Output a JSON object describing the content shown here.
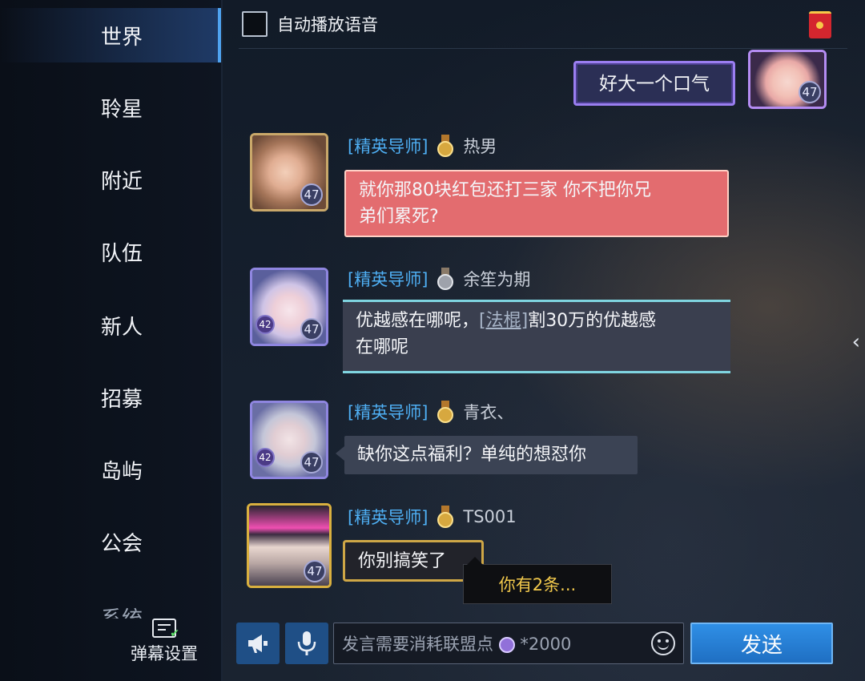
{
  "sidebar": {
    "items": [
      {
        "label": "世界",
        "active": true
      },
      {
        "label": "聆星"
      },
      {
        "label": "附近"
      },
      {
        "label": "队伍"
      },
      {
        "label": "新人"
      },
      {
        "label": "招募"
      },
      {
        "label": "岛屿"
      },
      {
        "label": "公会"
      },
      {
        "label": "系统"
      }
    ],
    "danmu_label": "弹幕设置"
  },
  "header": {
    "autoplay_label": "自动播放语音"
  },
  "messages": [
    {
      "own": true,
      "text": "好大一个口气",
      "level": "47"
    },
    {
      "title": "[精英导师]",
      "name": "热男",
      "text_line1": "就你那80块红包还打三家 你不把你兄",
      "text_line2": "弟们累死?",
      "level": "47"
    },
    {
      "title": "[精英导师]",
      "name": "余笙为期",
      "text_a": "优越感在哪呢，",
      "item_tag": "[法棍]",
      "text_b": "割30万的优越感",
      "text_line2": "在哪呢",
      "level": "47",
      "sublevel": "42"
    },
    {
      "title": "[精英导师]",
      "name": "青衣、",
      "text": "缺你这点福利？单纯的想怼你",
      "level": "47",
      "sublevel": "42"
    },
    {
      "title": "[精英导师]",
      "name": "TS001",
      "text": "你别搞笑了",
      "level": "47"
    }
  ],
  "notice": "你有2条...",
  "input": {
    "placeholder_prefix": "发言需要消耗联盟点",
    "placeholder_cost": "*2000"
  },
  "send_label": "发送",
  "colors": {
    "accent": "#4fa3f0",
    "title_blue": "#4fb0f5",
    "send_button": "#2f8fe6",
    "notice_text": "#f2c94c"
  }
}
